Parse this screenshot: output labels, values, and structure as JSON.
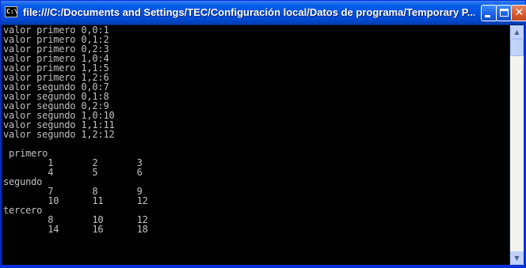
{
  "window": {
    "icon_label": "C:\\",
    "title": "file:///C:/Documents and Settings/TEC/Configuración local/Datos de programa/Temporary P..."
  },
  "controls": {
    "close_glyph": "✕"
  },
  "scrollbar": {
    "up_glyph": "▲",
    "down_glyph": "▼"
  },
  "console": {
    "lines": [
      "valor primero 0,0:1",
      "valor primero 0,1:2",
      "valor primero 0,2:3",
      "valor primero 1,0:4",
      "valor primero 1,1:5",
      "valor primero 1,2:6",
      "valor segundo 0,0:7",
      "valor segundo 0,1:8",
      "valor segundo 0,2:9",
      "valor segundo 1,0:10",
      "valor segundo 1,1:11",
      "valor segundo 1,2:12",
      "",
      " primero",
      "        1       2       3",
      "        4       5       6",
      "segundo",
      "        7       8       9",
      "        10      11      12",
      "tercero",
      "        8       10      12",
      "        14      16      18"
    ]
  }
}
